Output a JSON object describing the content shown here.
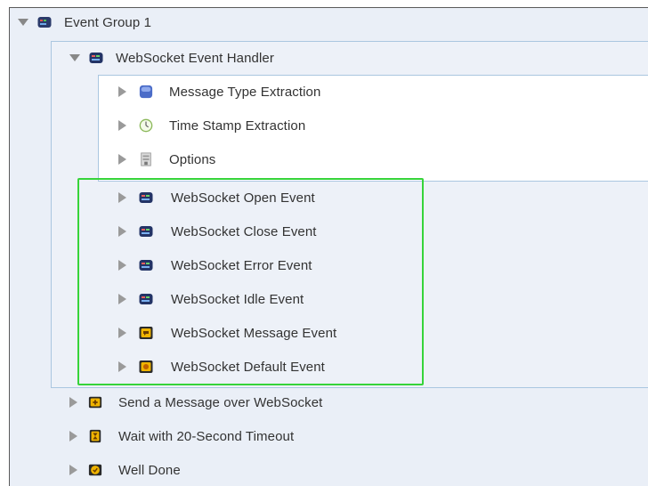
{
  "tree": {
    "root": {
      "label": "Event Group 1",
      "icon": "event-group-icon"
    },
    "handler": {
      "label": "WebSocket Event Handler",
      "icon": "event-handler-icon"
    },
    "handler_children": [
      {
        "label": "Message Type Extraction",
        "icon": "message-type-icon"
      },
      {
        "label": "Time Stamp Extraction",
        "icon": "clock-icon"
      },
      {
        "label": "Options",
        "icon": "options-icon"
      }
    ],
    "events": [
      {
        "label": "WebSocket Open Event",
        "icon": "event-icon"
      },
      {
        "label": "WebSocket Close Event",
        "icon": "event-icon"
      },
      {
        "label": "WebSocket Error Event",
        "icon": "event-icon"
      },
      {
        "label": "WebSocket Idle Event",
        "icon": "event-icon"
      },
      {
        "label": "WebSocket Message Event",
        "icon": "message-event-icon"
      },
      {
        "label": "WebSocket Default Event",
        "icon": "default-event-icon"
      }
    ],
    "actions": [
      {
        "label": "Send a Message over WebSocket",
        "icon": "send-message-icon"
      },
      {
        "label": "Wait with 20-Second Timeout",
        "icon": "wait-icon"
      },
      {
        "label": "Well Done",
        "icon": "well-done-icon"
      }
    ]
  },
  "colors": {
    "highlight": "#36d43a",
    "panel_border": "#aac6e0",
    "panel_bg": "#edf1f8"
  }
}
